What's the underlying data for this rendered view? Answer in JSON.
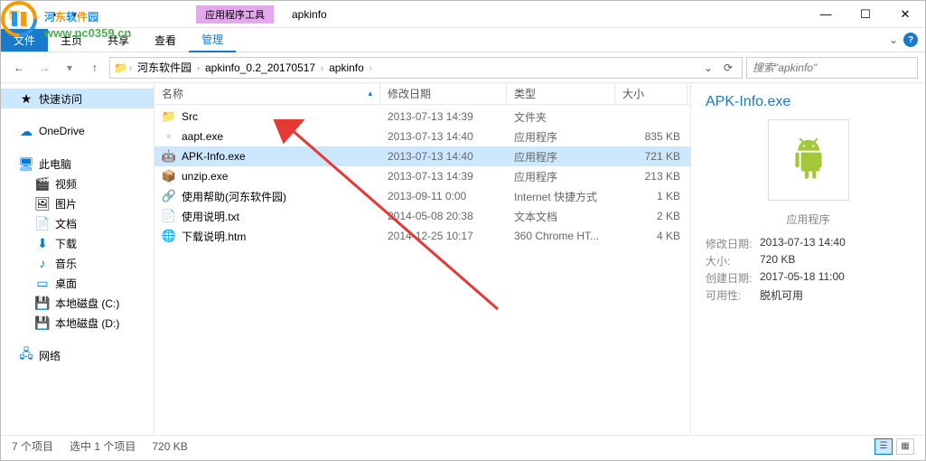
{
  "watermark": {
    "text": "河东软件园",
    "url": "www.pc0359.cn"
  },
  "titlebar": {
    "tools_tab": "应用程序工具",
    "title": "apkinfo"
  },
  "ribbon": {
    "file": "文件",
    "tabs": [
      "主页",
      "共享",
      "查看",
      "管理"
    ]
  },
  "breadcrumbs": [
    "河东软件园",
    "apkinfo_0.2_20170517",
    "apkinfo"
  ],
  "search_placeholder": "搜索\"apkinfo\"",
  "columns": {
    "name": "名称",
    "date": "修改日期",
    "type": "类型",
    "size": "大小"
  },
  "sidebar": {
    "quick": "快速访问",
    "onedrive": "OneDrive",
    "thispc": "此电脑",
    "video": "视频",
    "pictures": "图片",
    "docs": "文档",
    "downloads": "下载",
    "music": "音乐",
    "desktop": "桌面",
    "diskc": "本地磁盘 (C:)",
    "diskd": "本地磁盘 (D:)",
    "network": "网络"
  },
  "files": [
    {
      "name": "Src",
      "date": "2013-07-13 14:39",
      "type": "文件夹",
      "size": "",
      "icon": "folder"
    },
    {
      "name": "aapt.exe",
      "date": "2013-07-13 14:40",
      "type": "应用程序",
      "size": "835 KB",
      "icon": "exe"
    },
    {
      "name": "APK-Info.exe",
      "date": "2013-07-13 14:40",
      "type": "应用程序",
      "size": "721 KB",
      "icon": "android",
      "selected": true
    },
    {
      "name": "unzip.exe",
      "date": "2013-07-13 14:39",
      "type": "应用程序",
      "size": "213 KB",
      "icon": "zip"
    },
    {
      "name": "使用帮助(河东软件园)",
      "date": "2013-09-11 0:00",
      "type": "Internet 快捷方式",
      "size": "1 KB",
      "icon": "link"
    },
    {
      "name": "使用说明.txt",
      "date": "2014-05-08 20:38",
      "type": "文本文档",
      "size": "2 KB",
      "icon": "txt"
    },
    {
      "name": "下载说明.htm",
      "date": "2014-12-25 10:17",
      "type": "360 Chrome HT...",
      "size": "4 KB",
      "icon": "chrome"
    }
  ],
  "details": {
    "title": "APK-Info.exe",
    "type": "应用程序",
    "labels": {
      "modified": "修改日期:",
      "size": "大小:",
      "created": "创建日期:",
      "avail": "可用性:"
    },
    "modified": "2013-07-13 14:40",
    "size": "720 KB",
    "created": "2017-05-18 11:00",
    "avail": "脱机可用"
  },
  "status": {
    "items": "7 个项目",
    "selected": "选中 1 个项目",
    "size": "720 KB"
  }
}
